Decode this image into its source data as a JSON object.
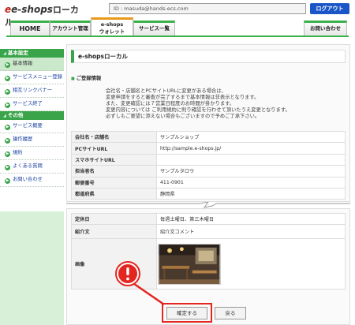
{
  "header": {
    "logo_part1": "e-shops",
    "logo_part2": "ローカル",
    "id_display": "ID : masuda@hands-ecs.com",
    "logout_label": "ログアウト"
  },
  "nav": {
    "home": "HOME",
    "account": "アカウント管理",
    "wallet_line1": "e-shops",
    "wallet_line2": "ウォレット",
    "services": "サービス一覧",
    "contact": "お問い合わせ"
  },
  "sidebar": {
    "group1": "基本設定",
    "group1_items": [
      "基本情報",
      "サービスメニュー登録",
      "相互リンクバナー",
      "サービス終了"
    ],
    "group2": "その他",
    "group2_items": [
      "サービス概要",
      "操作履歴",
      "規約",
      "よくある質問",
      "お問い合わせ"
    ]
  },
  "main": {
    "title": "e-shopsローカル",
    "section": "ご登録情報",
    "notice": [
      "会社名・店舗名とPCサイトURLに変更がある場合は、",
      "変更申請をすると審査が完了するまで基本情報は非表示となります。",
      "また、変更確認には７営業日程度のお時間が掛かります。",
      "変更内容については ご利用規約に則り確認を行わせて頂いたうえ変更となります。",
      "必ずしもご要望に添えない場合もございますので予めご了承下さい。"
    ],
    "rows_top": [
      {
        "label": "会社名・店舗名",
        "value": "サンプルショップ"
      },
      {
        "label": "PCサイトURL",
        "value": "http://sample.e-shops.jp/"
      },
      {
        "label": "スマホサイトURL",
        "value": ""
      },
      {
        "label": "担当者名",
        "value": "サンプルタロウ"
      },
      {
        "label": "郵便番号",
        "value": "411-0901"
      },
      {
        "label": "都道府県",
        "value": "静岡県"
      }
    ],
    "rows_bottom": [
      {
        "label": "定休日",
        "value": "毎週土曜日、第三木曜日"
      },
      {
        "label": "紹介文",
        "value": "紹介文コメント"
      },
      {
        "label": "画像",
        "value": ""
      }
    ],
    "confirm_label": "確定する",
    "back_label": "戻る"
  },
  "colors": {
    "brand_green": "#3aa44a",
    "logout_blue": "#1a56c8",
    "alert_red": "#e3261f"
  }
}
